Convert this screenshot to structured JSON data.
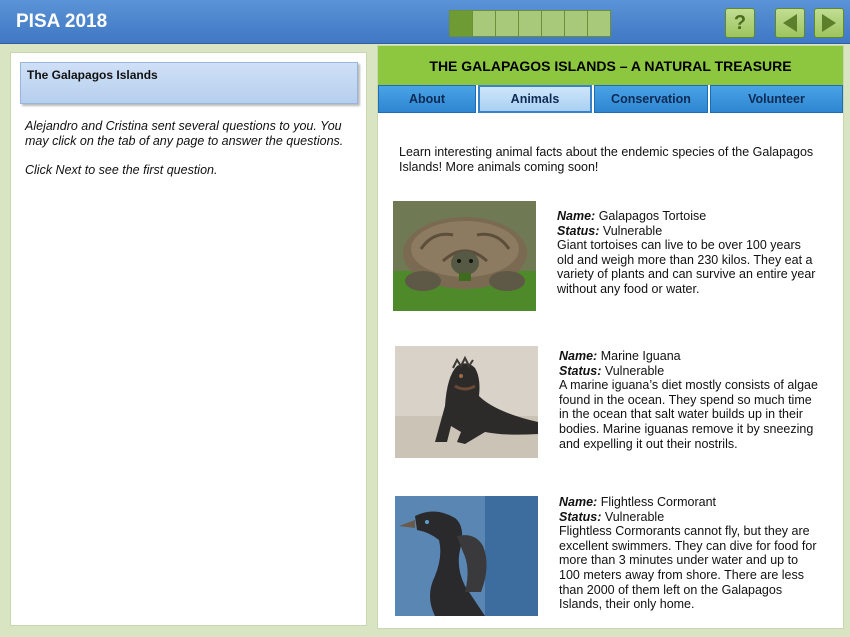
{
  "app": {
    "title": "PISA 2018"
  },
  "progress": {
    "total": 7,
    "completed": 1
  },
  "toolbar": {
    "help_label": "?",
    "help_icon": "question-icon",
    "back_icon": "arrow-left-icon",
    "next_icon": "arrow-right-icon"
  },
  "left": {
    "header": "The Galapagos Islands",
    "para1": "Alejandro and Cristina sent several questions to you. You may click on the tab of any page to answer the questions.",
    "para2": "Click Next to see the first question."
  },
  "site": {
    "title": "THE GALAPAGOS ISLANDS – A NATURAL TREASURE",
    "tabs": [
      {
        "label": "About"
      },
      {
        "label": "Animals",
        "active": true
      },
      {
        "label": "Conservation"
      },
      {
        "label": "Volunteer"
      }
    ],
    "intro": "Learn interesting animal facts about the endemic species of the Galapagos Islands!  More animals coming soon!",
    "name_label": "Name:",
    "status_label": "Status:",
    "animals": [
      {
        "name": "Galapagos Tortoise",
        "status": "Vulnerable",
        "description": "Giant tortoises can live to be over 100 years old and weigh more than 230 kilos.  They eat a variety of plants and can survive an entire year without any food or water."
      },
      {
        "name": "Marine Iguana",
        "status": "Vulnerable",
        "description": "A marine iguana’s diet mostly consists of algae found in the ocean.  They spend so much time in the ocean that salt water builds up in their bodies.  Marine iguanas remove it by sneezing and expelling it out their nostrils."
      },
      {
        "name": "Flightless Cormorant",
        "status": "Vulnerable",
        "description": "Flightless Cormorants cannot fly, but they are excellent swimmers.  They can dive for food for more than 3 minutes under water and up to 100 meters away from shore.  There are less than 2000 of them left on the Galapagos Islands, their only home."
      }
    ]
  },
  "colors": {
    "topbar": "#4a84cc",
    "site_title_bg": "#8dc63f",
    "tab_bg": "#2e86d1",
    "tab_active_bg": "#cfe5fa",
    "page_bg": "#d9e5c2"
  }
}
